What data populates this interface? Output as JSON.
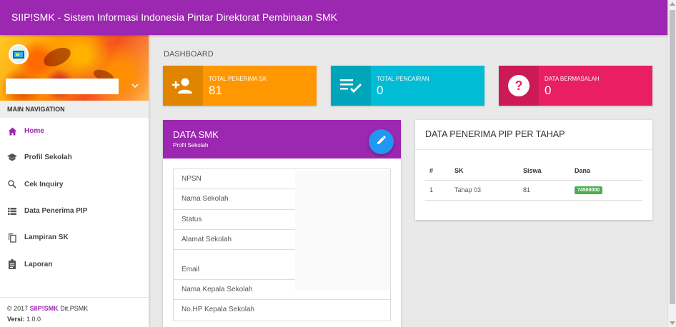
{
  "header": {
    "title": "SIIP!SMK - Sistem Informasi Indonesia Pintar Direktorat Pembinaan SMK"
  },
  "sidebar": {
    "nav_header": "MAIN NAVIGATION",
    "items": [
      {
        "label": "Home",
        "icon": "home-icon",
        "active": true
      },
      {
        "label": "Profil Sekolah",
        "icon": "school-icon"
      },
      {
        "label": "Cek Inquiry",
        "icon": "search-icon"
      },
      {
        "label": "Data Penerima PIP",
        "icon": "list-icon"
      },
      {
        "label": "Lampiran SK",
        "icon": "copy-icon"
      },
      {
        "label": "Laporan",
        "icon": "clipboard-icon"
      }
    ],
    "footer": {
      "copyright_prefix": "© 2017",
      "brand": "SIIP!SMK",
      "org": "Dit.PSMK",
      "version_label": "Versi:",
      "version": "1.0.0"
    }
  },
  "page": {
    "title": "DASHBOARD"
  },
  "info_boxes": [
    {
      "label": "TOTAL PENERIMA SK",
      "value": "81",
      "icon": "person-add-icon",
      "color": "#ff9800"
    },
    {
      "label": "TOTAL PENCAIRAN",
      "value": "0",
      "icon": "playlist-check-icon",
      "color": "#00bcd4"
    },
    {
      "label": "DATA BERMASALAH",
      "value": "0",
      "icon": "help-icon",
      "color": "#e91e63"
    }
  ],
  "data_smk": {
    "title": "DATA SMK",
    "subtitle": "Profil Sekolah",
    "fields": [
      "NPSN",
      "Nama Sekolah",
      "Status",
      "Alamat Sekolah",
      "Email",
      "Nama Kepala Sekolah",
      "No.HP Kepala Sekolah"
    ]
  },
  "pip": {
    "title": "DATA PENERIMA PIP PER TAHAP",
    "columns": [
      "#",
      "SK",
      "Siswa",
      "Dana"
    ],
    "rows": [
      {
        "no": "1",
        "sk": "Tahap 03",
        "siswa": "81",
        "dana": "74500000"
      }
    ]
  },
  "colors": {
    "primary": "#9c27b0",
    "accent": "#2196f3",
    "success": "#4caf50"
  }
}
